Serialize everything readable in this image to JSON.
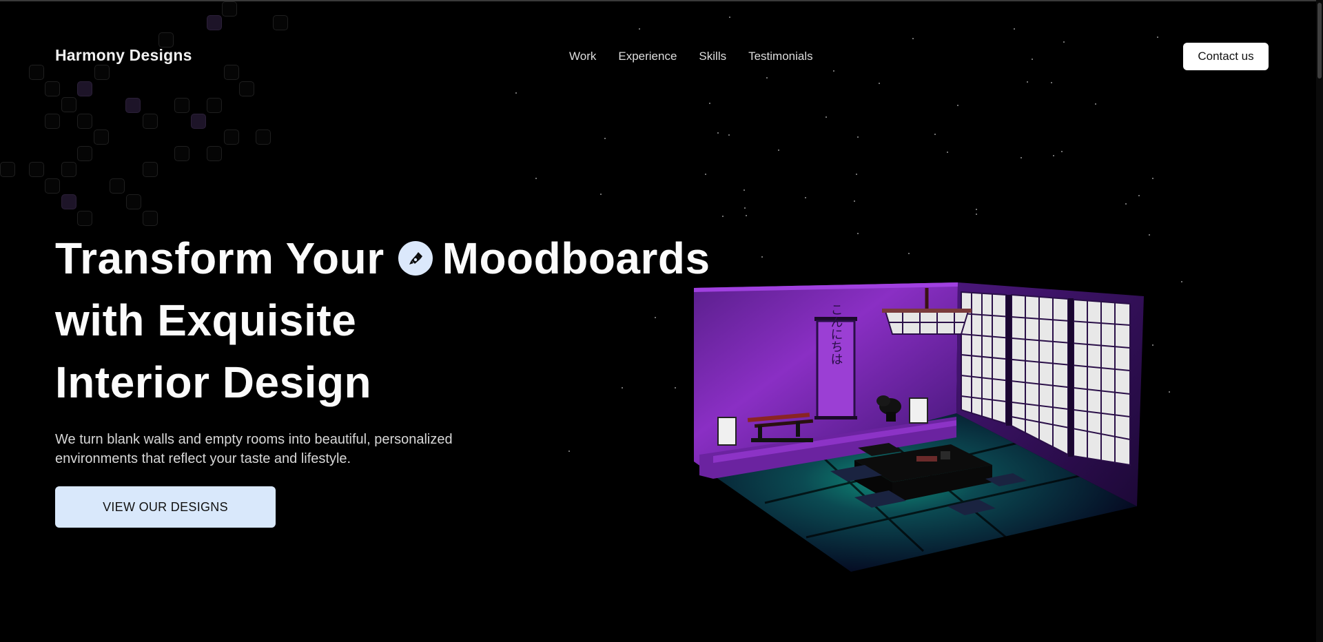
{
  "header": {
    "brand": "Harmony Designs",
    "nav": [
      "Work",
      "Experience",
      "Skills",
      "Testimonials"
    ],
    "contact_label": "Contact us"
  },
  "hero": {
    "title_line1_a": "Transform Your",
    "title_line1_b": "Moodboards",
    "title_line2": "with Exquisite",
    "title_line3": "Interior Design",
    "subtitle_line1": "We turn blank walls and empty rooms into beautiful, personalized",
    "subtitle_line2": "environments that reflect your taste and lifestyle.",
    "cta_label": "VIEW OUR DESIGNS",
    "title_icon": "design-tool-icon"
  },
  "illustration": {
    "scroll_text": "こんにちは",
    "icon": "japanese-room-illustration"
  },
  "colors": {
    "background": "#000000",
    "accent_light_blue": "#d9e8fb",
    "room_purple": "#7a2bb3",
    "floor_teal": "#0f5a5a"
  }
}
